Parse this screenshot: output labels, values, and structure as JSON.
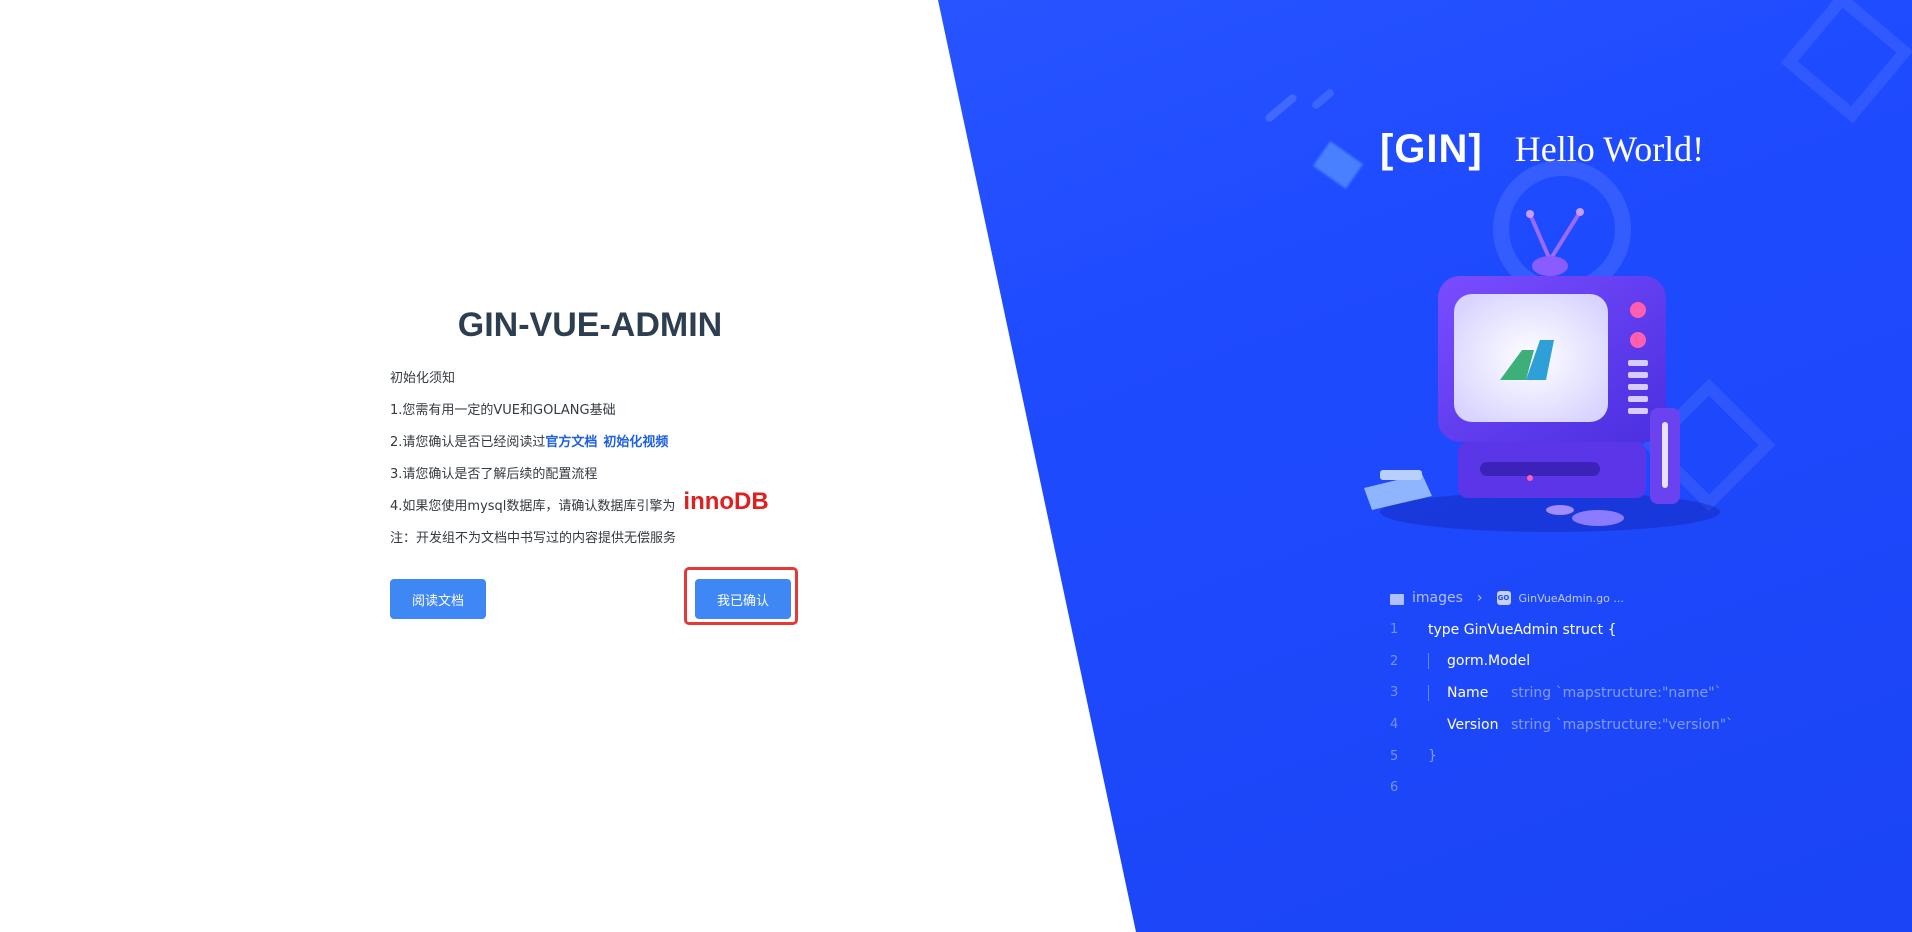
{
  "colors": {
    "brand_blue": "#1f4bff",
    "button_blue": "#3f87f5",
    "title_dark": "#2c3e50",
    "link_blue": "#1f60e0",
    "engine_red": "#e02020",
    "highlight_red": "#e53935"
  },
  "hero": {
    "gin_logo": "[GIN]",
    "greeting": "Hello World!"
  },
  "code": {
    "breadcrumb_folder": "images",
    "breadcrumb_file": "GinVueAdmin.go ...",
    "lines": [
      {
        "num": "1",
        "text": "type GinVueAdmin struct {"
      },
      {
        "num": "2",
        "name": "gorm.Model",
        "rest": ""
      },
      {
        "num": "3",
        "name": "Name",
        "rest": "string `mapstructure:\"name\"`"
      },
      {
        "num": "4",
        "name": "Version",
        "rest": "string `mapstructure:\"version\"`"
      },
      {
        "num": "5",
        "text": "}"
      },
      {
        "num": "6",
        "text": ""
      }
    ]
  },
  "init": {
    "title": "GIN-VUE-ADMIN",
    "notice_heading": "初始化须知",
    "step1": "1.您需有用一定的VUE和GOLANG基础",
    "step2_prefix": "2.请您确认是否已经阅读过",
    "step2_link_docs": "官方文档",
    "step2_link_video": "初始化视频",
    "step3": "3.请您确认是否了解后续的配置流程",
    "step4_prefix": "4.如果您使用mysql数据库，请确认数据库引擎为",
    "step4_engine": "innoDB",
    "note": "注：开发组不为文档中书写过的内容提供无偿服务",
    "read_docs_button": "阅读文档",
    "confirm_button": "我已确认"
  }
}
